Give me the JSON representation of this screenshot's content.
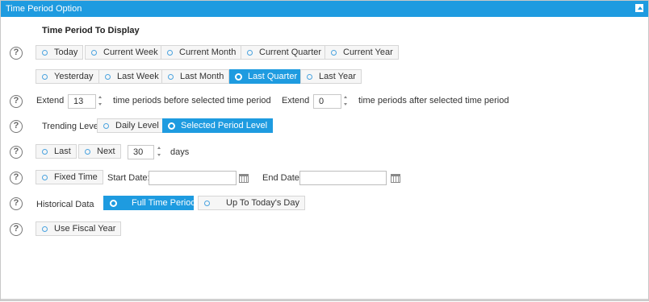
{
  "panel": {
    "title": "Time Period Option"
  },
  "section_title": "Time Period To Display",
  "help_glyph": "?",
  "period_row1": [
    "Today",
    "Current Week",
    "Current Month",
    "Current Quarter",
    "Current Year"
  ],
  "period_row2": [
    "Yesterday",
    "Last Week",
    "Last Month",
    "Last Quarter",
    "Last Year"
  ],
  "selected_period": "Last Quarter",
  "extend": {
    "label_before": "Extend",
    "before_value": "13",
    "before_text": "time periods before selected time period",
    "label_after": "Extend",
    "after_value": "0",
    "after_text": "time periods after selected time period"
  },
  "trending": {
    "label": "Trending Level",
    "options": [
      "Daily Level",
      "Selected Period Level"
    ],
    "selected": "Selected Period Level"
  },
  "last_next": {
    "options": [
      "Last",
      "Next"
    ],
    "value": "30",
    "unit": "days"
  },
  "fixed_time": {
    "option": "Fixed Time",
    "start_label": "Start Date:",
    "start_value": "",
    "end_label": "End Date:",
    "end_value": ""
  },
  "historical": {
    "label": "Historical Data",
    "options": [
      "Full Time Period",
      "Up To Today's Day"
    ],
    "selected": "Full Time Period"
  },
  "fiscal": {
    "option": "Use Fiscal Year"
  },
  "colors": {
    "accent": "#1e9be0",
    "border": "#d6d6d6",
    "option_bg": "#f6f6f6"
  }
}
